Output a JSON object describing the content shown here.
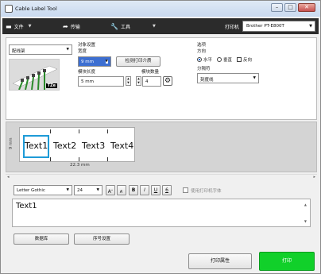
{
  "window": {
    "title": "Cable Label Tool",
    "min": "–",
    "max": "□",
    "close": "✕"
  },
  "toolbar": {
    "file_label": "文件",
    "transfer_label": "传输",
    "tools_label": "工具",
    "printer_label": "打印机",
    "printer_value": "Brother PT-E800T"
  },
  "settings": {
    "label_type": "配线架",
    "object_settings_title": "对象设置",
    "width_label": "宽度",
    "width_value": "9 mm",
    "check_tape_button": "检测打印介质",
    "block_length_label": "模块长度",
    "block_length_value": "5 mm",
    "block_count_label": "模块数量",
    "block_count_value": "4",
    "options_title": "选项",
    "direction_label": "方向",
    "direction_horizontal": "水平",
    "direction_vertical": "垂直",
    "reverse_label": "反向",
    "separator_label": "分隔符",
    "separator_value": "刻度线",
    "tape_badge": "TZe"
  },
  "preview": {
    "side_dim": "9 mm",
    "cells": [
      "Text1",
      "Text2",
      "Text3",
      "Text4"
    ],
    "bottom_dim": "22.3 mm"
  },
  "format": {
    "font": "Letter Gothic",
    "size": "24",
    "grow": "A",
    "shrink": "A",
    "bold": "B",
    "italic": "I",
    "underline": "U",
    "frame": "6",
    "use_printer_font": "使用打印机字体"
  },
  "text_input": {
    "value": "Text1"
  },
  "actions": {
    "database_button": "数据库",
    "numbering_button": "序号设置",
    "print_properties_button": "打印属性",
    "print_button": "打印"
  },
  "colors": {
    "accent_green": "#11d02a",
    "selection_blue": "#1e9bd7",
    "toolbar_bg": "#2b2b2b"
  }
}
